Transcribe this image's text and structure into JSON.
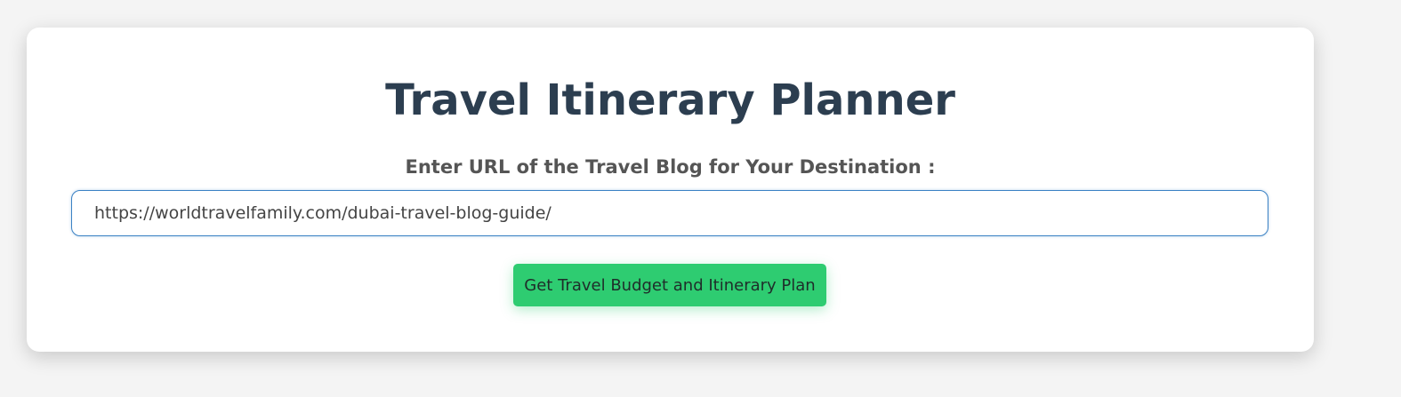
{
  "page": {
    "title": "Travel Itinerary Planner"
  },
  "form": {
    "url_label": "Enter URL of the Travel Blog for Your Destination :",
    "url_value": "https://worldtravelfamily.com/dubai-travel-blog-guide/",
    "submit_label": "Get Travel Budget and Itinerary Plan"
  },
  "colors": {
    "background": "#f4f4f4",
    "card": "#ffffff",
    "title": "#2c3e50",
    "label": "#555555",
    "input_border": "#3b82c4",
    "button": "#2ecc71"
  }
}
